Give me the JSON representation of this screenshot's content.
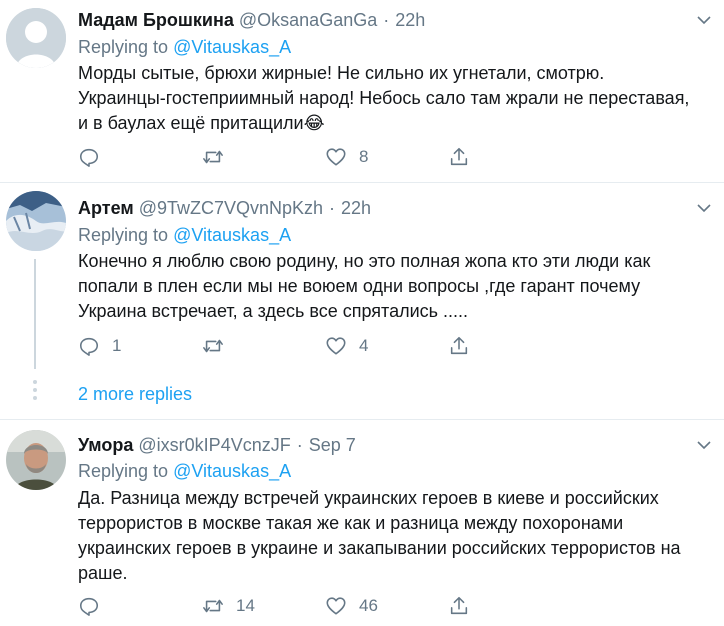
{
  "tweets": [
    {
      "name": "Мадам Брошкина",
      "handle": "@OksanaGanGa",
      "time": "22h",
      "reply_prefix": "Replying to",
      "reply_to": "@Vitauskas_A",
      "lines": [
        "Морды сытые, брюхи жирные! Не сильно их угнетали, смотрю.",
        "Украинцы-гостеприимный народ! Небось сало там жрали не переставая,",
        "и в баулах ещё притащили😂"
      ],
      "replies": "",
      "retweets": "",
      "likes": "8"
    },
    {
      "name": "Артем",
      "handle": "@9TwZC7VQvnNpKzh",
      "time": "22h",
      "reply_prefix": "Replying to",
      "reply_to": "@Vitauskas_A",
      "lines": [
        "Конечно я люблю свою родину, но это полная жопа кто эти люди как",
        "попали в плен если мы не воюем одни вопросы ,где гарант почему",
        "Украина встречает, а здесь все спрятались ....."
      ],
      "replies": "1",
      "retweets": "",
      "likes": "4"
    },
    {
      "name": "Умора",
      "handle": "@ixsr0kIP4VcnzJF",
      "time": "Sep 7",
      "reply_prefix": "Replying to",
      "reply_to": "@Vitauskas_A",
      "lines": [
        "Да. Разница между встречей украинских героев в киеве и российских",
        "террористов в москве такая же как и разница между похоронами",
        "украинских героев в украине и закапывании российских террористов на",
        "раше."
      ],
      "replies": "",
      "retweets": "14",
      "likes": "46"
    }
  ],
  "more_replies": "2 more replies",
  "colors": {
    "accent": "#1da1f2",
    "secondary_text": "#657786",
    "divider": "#e6ecf0",
    "thread_line": "#ccd6dd"
  },
  "icons": [
    "reply-icon",
    "retweet-icon",
    "like-icon",
    "share-icon",
    "caret-down-icon"
  ]
}
